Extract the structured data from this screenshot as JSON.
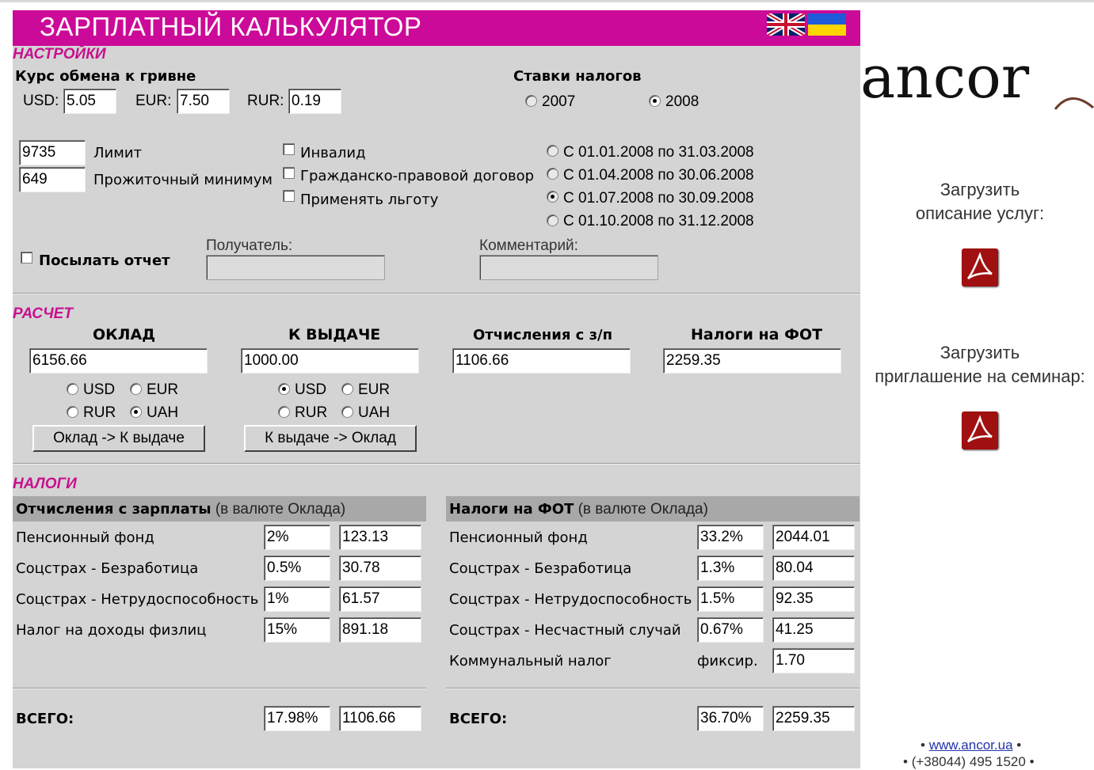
{
  "header": {
    "title": "ЗАРПЛАТНЫЙ КАЛЬКУЛЯТОР"
  },
  "settings": {
    "section_label": "НАСТРОЙКИ",
    "exchange_label": "Курс обмена к гривне",
    "usd_label": "USD:",
    "usd_value": "5.05",
    "eur_label": "EUR:",
    "eur_value": "7.50",
    "rur_label": "RUR:",
    "rur_value": "0.19",
    "tax_rates_label": "Ставки налогов",
    "year_2007": "2007",
    "year_2008": "2008",
    "limit_value": "9735",
    "limit_label": "Лимит",
    "min_value": "649",
    "min_label": "Прожиточный минимум",
    "invalid_label": "Инвалид",
    "civil_contract_label": "Гражданско-правовой договор",
    "apply_benefit_label": "Применять льготу",
    "periods": [
      "С 01.01.2008 по 31.03.2008",
      "С 01.04.2008 по 30.06.2008",
      "С 01.07.2008 по 30.09.2008",
      "С 01.10.2008 по 31.12.2008"
    ],
    "send_report_label": "Посылать отчет",
    "recipient_label": "Получатель:",
    "comment_label": "Комментарий:"
  },
  "calc": {
    "section_label": "РАСЧЕТ",
    "salary_header": "ОКЛАД",
    "salary_value": "6156.66",
    "payout_header": "К ВЫДАЧЕ",
    "payout_value": "1000.00",
    "deductions_header": "Отчисления с з/п",
    "deductions_value": "1106.66",
    "payroll_tax_header": "Налоги на ФОТ",
    "payroll_tax_value": "2259.35",
    "cur_usd": "USD",
    "cur_eur": "EUR",
    "cur_rur": "RUR",
    "cur_uah": "UAH",
    "btn_salary_to_payout": "Оклад -> К выдаче",
    "btn_payout_to_salary": "К выдаче -> Оклад"
  },
  "taxes": {
    "section_label": "НАЛОГИ",
    "left_header_bold": "Отчисления с зарплаты",
    "left_header_rest": "(в валюте Оклада)",
    "right_header_bold": "Налоги на ФОТ",
    "right_header_rest": "(в валюте Оклада)",
    "left_rows": [
      {
        "label": "Пенсионный фонд",
        "pct": "2%",
        "amount": "123.13"
      },
      {
        "label": "Соцстрах - Безработица",
        "pct": "0.5%",
        "amount": "30.78"
      },
      {
        "label": "Соцстрах - Нетрудоспособность",
        "pct": "1%",
        "amount": "61.57"
      },
      {
        "label": "Налог на доходы физлиц",
        "pct": "15%",
        "amount": "891.18"
      }
    ],
    "right_rows": [
      {
        "label": "Пенсионный фонд",
        "pct": "33.2%",
        "amount": "2044.01"
      },
      {
        "label": "Соцстрах - Безработица",
        "pct": "1.3%",
        "amount": "80.04"
      },
      {
        "label": "Соцстрах - Нетрудоспособность",
        "pct": "1.5%",
        "amount": "92.35"
      },
      {
        "label": "Соцстрах - Несчастный случай",
        "pct": "0.67%",
        "amount": "41.25"
      },
      {
        "label": "Коммунальный налог",
        "pct": "фиксир.",
        "amount": "1.70"
      }
    ],
    "total_label": "ВСЕГО:",
    "left_total_pct": "17.98%",
    "left_total_amount": "1106.66",
    "right_total_pct": "36.70%",
    "right_total_amount": "2259.35"
  },
  "sidebar": {
    "logo": "ancor",
    "download_services_line1": "Загрузить",
    "download_services_line2": "описание услуг:",
    "download_seminar_line1": "Загрузить",
    "download_seminar_line2": "приглашение на семинар:",
    "website": "www.ancor.ua",
    "phone": "(+38044) 495 1520"
  },
  "colors": {
    "accent": "#cc0a99",
    "panel": "#d4d4d4",
    "table_header": "#a8a8a8"
  },
  "icons": [
    "flag-uk-icon",
    "flag-ua-icon",
    "pdf-icon"
  ]
}
